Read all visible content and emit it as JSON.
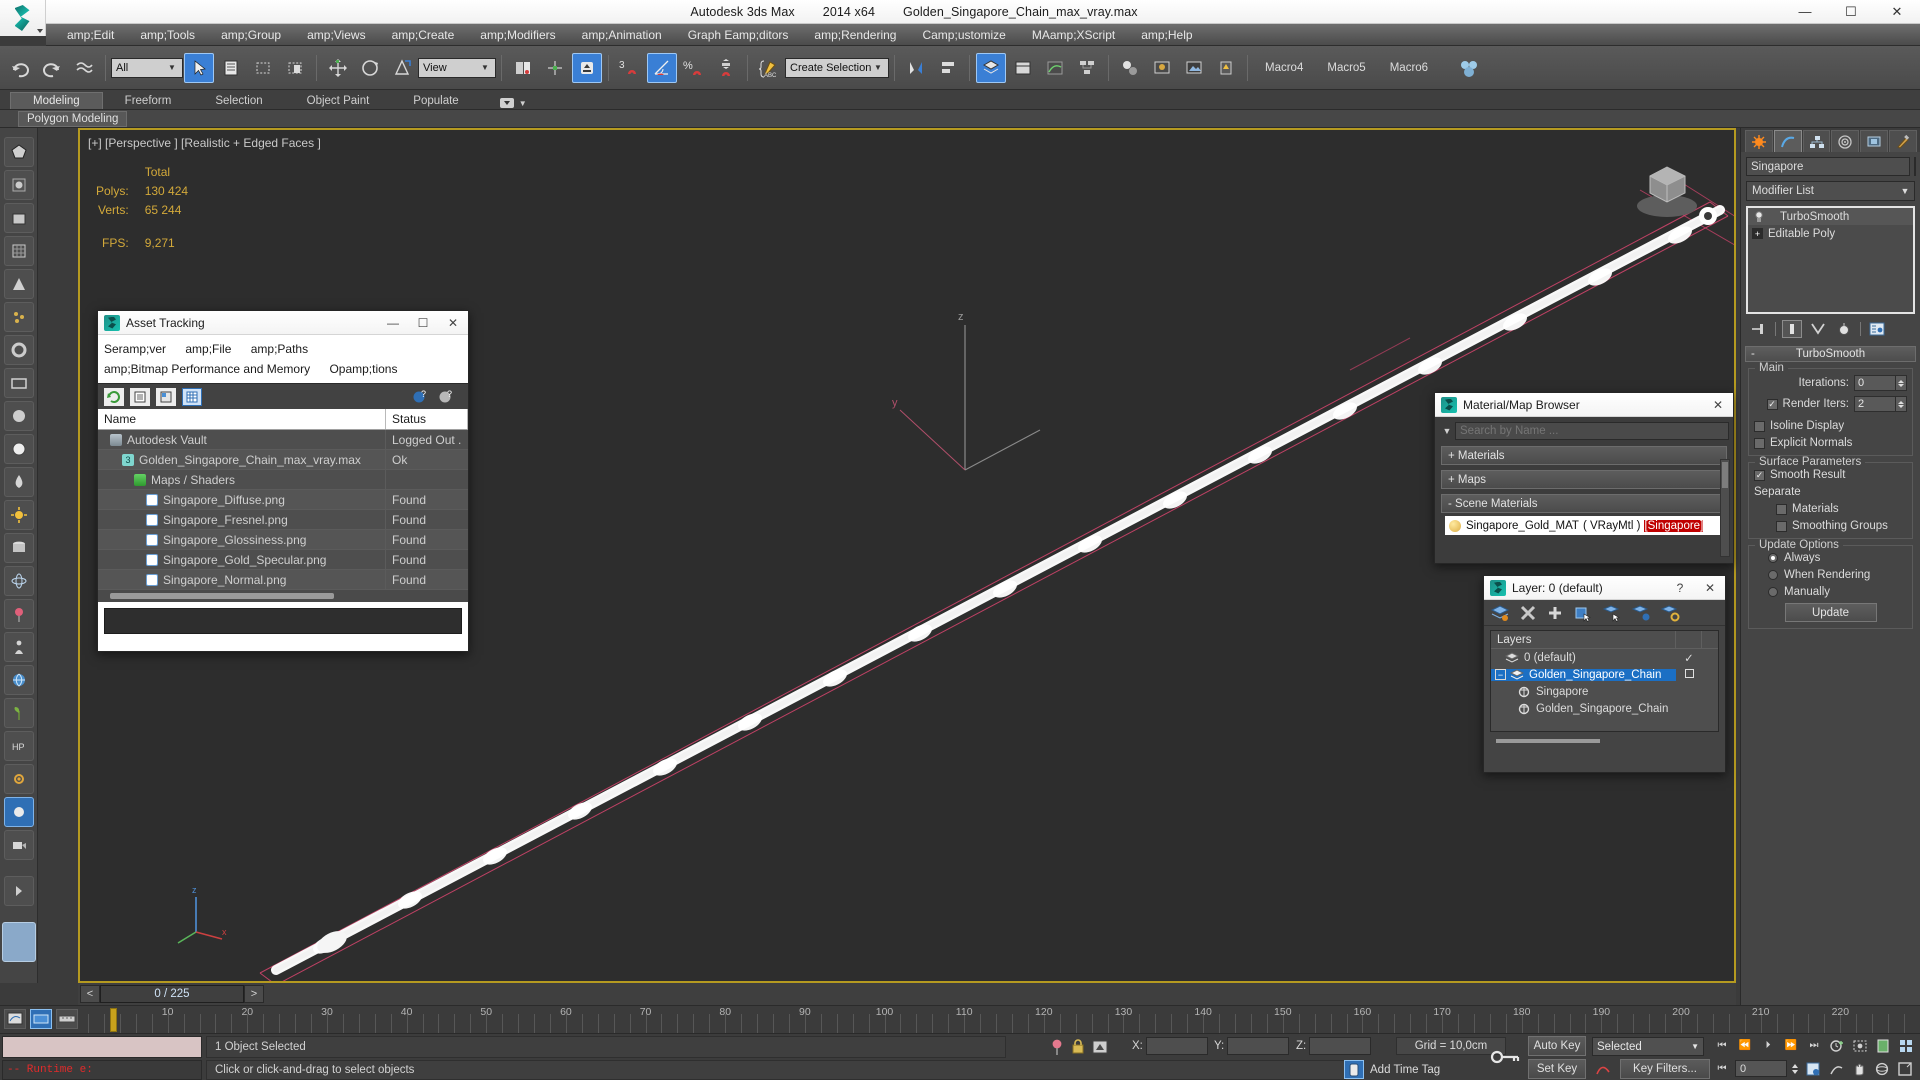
{
  "window": {
    "app_name": "Autodesk 3ds Max",
    "version": "2014 x64",
    "file_name": "Golden_Singapore_Chain_max_vray.max",
    "minimize": "—",
    "maximize": "☐",
    "close": "✕"
  },
  "menubar": {
    "items": [
      "amp;Edit",
      "amp;Tools",
      "amp;Group",
      "amp;Views",
      "amp;Create",
      "amp;Modifiers",
      "amp;Animation",
      "Graph Eamp;ditors",
      "amp;Rendering",
      "Camp;ustomize",
      "MAamp;XScript",
      "amp;Help"
    ]
  },
  "toolbar": {
    "selection_filter": "All",
    "ref_coord_system": "View",
    "named_selection_set": "Create Selection Se",
    "macros": [
      "Macro4",
      "Macro5",
      "Macro6"
    ]
  },
  "ribbon": {
    "tabs": [
      "Modeling",
      "Freeform",
      "Selection",
      "Object Paint",
      "Populate"
    ],
    "active_tab": "Modeling",
    "subtitle": "Polygon Modeling"
  },
  "viewport": {
    "label": "[+] [Perspective ] [Realistic + Edged Faces ]",
    "stats_header": "Total",
    "stats": [
      {
        "label": "Polys:",
        "value": "130 424"
      },
      {
        "label": "Verts:",
        "value": "65 244"
      }
    ],
    "fps_label": "FPS:",
    "fps_value": "9,271",
    "axis_labels": [
      "x",
      "y",
      "z"
    ],
    "accent_border": "#b59a20"
  },
  "asset_tracking": {
    "title": "Asset Tracking",
    "menus_row1": [
      "Seramp;ver",
      "amp;File",
      "amp;Paths"
    ],
    "menus_row2": [
      "amp;Bitmap Performance and Memory",
      "Opamp;tions"
    ],
    "columns": [
      "Name",
      "Status"
    ],
    "rows": [
      {
        "name": "Autodesk Vault",
        "status": "Logged Out .",
        "indent": 0,
        "icon": "vault-icon"
      },
      {
        "name": "Golden_Singapore_Chain_max_vray.max",
        "status": "Ok",
        "indent": 1,
        "icon": "max-file-icon"
      },
      {
        "name": "Maps / Shaders",
        "status": "",
        "indent": 2,
        "icon": "maps-icon"
      },
      {
        "name": "Singapore_Diffuse.png",
        "status": "Found",
        "indent": 3,
        "icon": "bitmap-icon"
      },
      {
        "name": "Singapore_Fresnel.png",
        "status": "Found",
        "indent": 3,
        "icon": "bitmap-icon"
      },
      {
        "name": "Singapore_Glossiness.png",
        "status": "Found",
        "indent": 3,
        "icon": "bitmap-icon"
      },
      {
        "name": "Singapore_Gold_Specular.png",
        "status": "Found",
        "indent": 3,
        "icon": "bitmap-icon"
      },
      {
        "name": "Singapore_Normal.png",
        "status": "Found",
        "indent": 3,
        "icon": "bitmap-icon"
      }
    ]
  },
  "material_browser": {
    "title": "Material/Map Browser",
    "search_placeholder": "Search by Name ...",
    "groups": [
      {
        "label": "+ Materials"
      },
      {
        "label": "+ Maps"
      },
      {
        "label": "- Scene Materials"
      }
    ],
    "scene_material": {
      "name": "Singapore_Gold_MAT",
      "type": "( VRayMtl )",
      "assigned": "[Singapore",
      "assigned_tail": "]"
    }
  },
  "layer_window": {
    "title": "Layer: 0 (default)",
    "help": "?",
    "close": "✕",
    "column_header": "Layers",
    "rows": [
      {
        "label": "0 (default)",
        "indent": 0,
        "checked": true,
        "selected": false
      },
      {
        "label": "Golden_Singapore_Chain",
        "indent": 0,
        "checked": false,
        "selected": true
      },
      {
        "label": "Singapore",
        "indent": 1,
        "checked": false,
        "selected": false
      },
      {
        "label": "Golden_Singapore_Chain",
        "indent": 1,
        "checked": false,
        "selected": false
      }
    ]
  },
  "command_panel": {
    "object_name": "Singapore",
    "modifier_list_label": "Modifier List",
    "stack": [
      "TurboSmooth",
      "Editable Poly"
    ],
    "rollup_title": "TurboSmooth",
    "rollup_collapse": "-",
    "main_group": "Main",
    "iterations_label": "Iterations:",
    "iterations_value": "0",
    "render_iters_label": "Render Iters:",
    "render_iters_value": "2",
    "render_iters_checked": true,
    "isoline_label": "Isoline Display",
    "explicit_normals_label": "Explicit Normals",
    "surface_group": "Surface Parameters",
    "smooth_result_label": "Smooth Result",
    "smooth_result_checked": true,
    "separate_label": "Separate",
    "materials_label": "Materials",
    "smoothing_groups_label": "Smoothing Groups",
    "update_group": "Update Options",
    "update_options": [
      "Always",
      "When Rendering",
      "Manually"
    ],
    "update_selected": "Always",
    "update_button": "Update"
  },
  "timeslider": {
    "prev": "<",
    "next": ">",
    "current": "0 / 225",
    "ruler_max": 230,
    "ruler_labels": [
      10,
      20,
      30,
      40,
      50,
      60,
      70,
      80,
      90,
      100,
      110,
      120,
      130,
      140,
      150,
      160,
      170,
      180,
      190,
      200,
      210,
      220
    ]
  },
  "statusbar": {
    "runtime_text": "-- Runtime e:",
    "selection_text": "1 Object Selected",
    "prompt_text": "Click or click-and-drag to select objects",
    "x_label": "X:",
    "y_label": "Y:",
    "z_label": "Z:",
    "x_value": "",
    "y_value": "",
    "z_value": "",
    "grid_label": "Grid = 10,0cm",
    "add_time_tag": "Add Time Tag",
    "auto_key": "Auto Key",
    "set_key": "Set Key",
    "key_mode": "Selected",
    "key_filters": "Key Filters...",
    "frame_value": "0"
  }
}
